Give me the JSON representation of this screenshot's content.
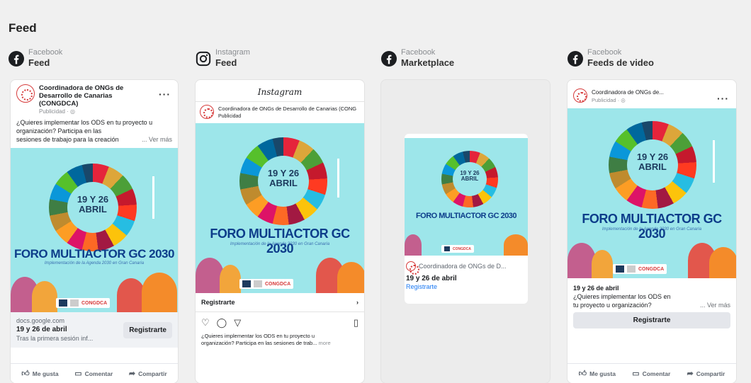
{
  "section_title": "Feed",
  "columns": [
    {
      "platform": "Facebook",
      "placement": "Feed"
    },
    {
      "platform": "Instagram",
      "placement": "Feed"
    },
    {
      "platform": "Facebook",
      "placement": "Marketplace"
    },
    {
      "platform": "Facebook",
      "placement": "Feeds de video"
    }
  ],
  "creative": {
    "date_line1": "19 Y 26",
    "date_line2": "ABRIL",
    "title": "FORO MULTIACTOR GC 2030",
    "subtitle": "Implementación de la Agenda 2030 en Gran Canaria",
    "logo_text": "CONGDCA"
  },
  "fb_feed": {
    "page_name": "Coordinadora de ONGs de Desarrollo de Canarias (CONGDCA)",
    "sponsored": "Publicidad · ◎",
    "body_lines": [
      "¿Quieres implementar los ODS en tu proyecto u",
      "organización? Participa en las",
      "sesiones de trabajo para la creación"
    ],
    "see_more": "... Ver más",
    "domain": "docs.google.com",
    "headline": "19 y 26 de abril",
    "description": "Tras la primera sesión inf...",
    "cta": "Registrarte",
    "like": "Me gusta",
    "comment": "Comentar",
    "share": "Compartir"
  },
  "ig_feed": {
    "brand": "Instagram",
    "page_name": "Coordinadora de ONGs de Desarrollo de Canarias (CONG",
    "sponsored": "Publicidad",
    "cta": "Registrarte",
    "caption": "¿Quieres implementar los ODS en tu proyecto u",
    "caption2": "organización? Participa en las sesiones de trab...",
    "more": "more"
  },
  "marketplace": {
    "page_name": "Coordinadora de ONGs de D...",
    "headline": "19 y 26 de abril",
    "cta": "Registrarte"
  },
  "fb_video": {
    "page_name": "Coordinadora de ONGs de...",
    "sponsored": "Publicidad · ◎",
    "headline": "19 y 26 de abril",
    "body_line1": "¿Quieres implementar los ODS en",
    "body_line2": "tu proyecto u organización?",
    "see_more": "... Ver más",
    "cta": "Registrarte",
    "like": "Me gusta",
    "comment": "Comentar",
    "share": "Compartir"
  },
  "colors": {
    "facebook": "#1c1e21",
    "link": "#1877f2",
    "creative_bg": "#9de6ea"
  }
}
